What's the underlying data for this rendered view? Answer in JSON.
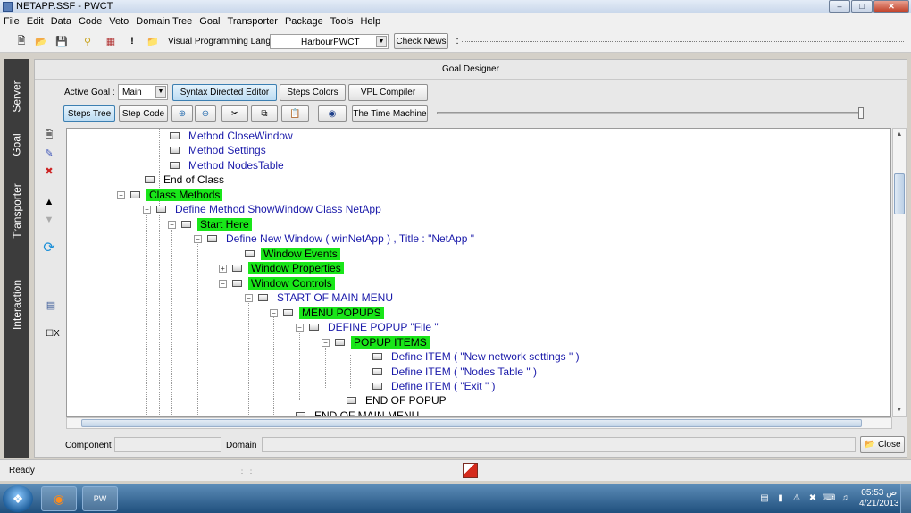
{
  "window": {
    "title": "NETAPP.SSF - PWCT"
  },
  "menu": [
    "File",
    "Edit",
    "Data",
    "Code",
    "Veto",
    "Domain Tree",
    "Goal",
    "Transporter",
    "Package",
    "Tools",
    "Help"
  ],
  "toolbar": {
    "vpl_label": "Visual Programming Language",
    "vpl_value": "HarbourPWCT",
    "check_news": "Check News",
    "separator": ":"
  },
  "side_tabs": [
    "Server",
    "Goal",
    "Transporter",
    "Interaction"
  ],
  "designer": {
    "title": "Goal Designer",
    "active_goal_label": "Active Goal :",
    "active_goal_value": "Main",
    "buttons": {
      "syntax_editor": "Syntax Directed Editor",
      "steps_colors": "Steps Colors",
      "vpl_compiler": "VPL Compiler",
      "steps_tree": "Steps Tree",
      "step_code": "Step Code",
      "time_machine": "The Time Machine"
    },
    "checkbox_label": "X"
  },
  "tree": [
    {
      "label": "Method CloseWindow",
      "style": "blue"
    },
    {
      "label": "Method Settings",
      "style": "blue"
    },
    {
      "label": "Method NodesTable",
      "style": "blue"
    },
    {
      "label": "End of Class",
      "style": "black"
    },
    {
      "label": "Class Methods",
      "style": "hl"
    },
    {
      "label": "Define Method ShowWindow Class NetApp",
      "style": "blue"
    },
    {
      "label": "Start Here",
      "style": "hl"
    },
    {
      "label": "Define New Window  ( winNetApp ) , Title : \"NetApp  \"",
      "style": "blue"
    },
    {
      "label": "Window Events",
      "style": "hl"
    },
    {
      "label": "Window Properties",
      "style": "hl"
    },
    {
      "label": "Window Controls",
      "style": "hl"
    },
    {
      "label": "START OF MAIN MENU",
      "style": "blue"
    },
    {
      "label": "MENU POPUPS",
      "style": "hl"
    },
    {
      "label": "DEFINE POPUP \"File \"",
      "style": "blue"
    },
    {
      "label": "POPUP ITEMS",
      "style": "hl"
    },
    {
      "label": "Define ITEM  ( \"New network settings \" )",
      "style": "blue"
    },
    {
      "label": "Define ITEM  ( \"Nodes Table \" )",
      "style": "blue"
    },
    {
      "label": "Define ITEM  ( \"Exit \" )",
      "style": "blue"
    },
    {
      "label": "END OF POPUP",
      "style": "black"
    },
    {
      "label": "END OF MAIN MENU",
      "style": "black"
    }
  ],
  "bottom": {
    "component_label": "Component",
    "domain_label": "Domain",
    "close_button": "Close"
  },
  "status": {
    "text": "Ready"
  },
  "taskbar": {
    "time": "05:53 ص",
    "date": "4/21/2013"
  }
}
